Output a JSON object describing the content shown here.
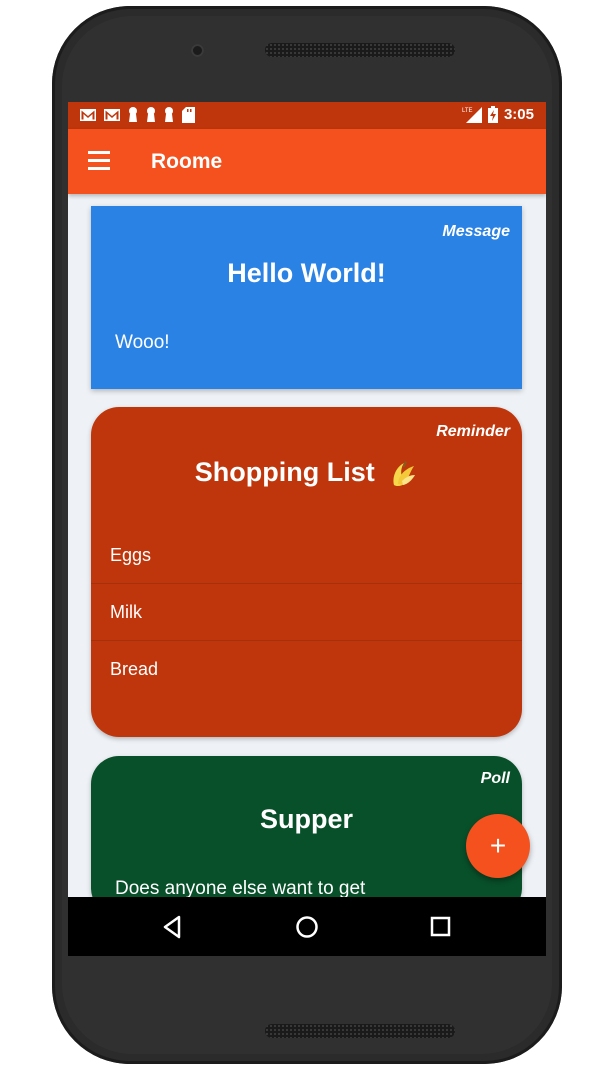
{
  "app": {
    "title": "Roome"
  },
  "status_bar": {
    "time": "3:05",
    "network": "LTE"
  },
  "cards": {
    "message": {
      "type": "Message",
      "title": "Hello World!",
      "body": "Wooo!"
    },
    "reminder": {
      "type": "Reminder",
      "title": "Shopping List",
      "items": [
        "Eggs",
        "Milk",
        "Bread"
      ]
    },
    "poll": {
      "type": "Poll",
      "title": "Supper",
      "body": "Does anyone else want to get"
    }
  },
  "fab": {
    "label": "+"
  },
  "colors": {
    "status_bar": "#bf360c",
    "app_bar": "#f4511e",
    "message_card": "#2a82e4",
    "reminder_card": "#bf360c",
    "poll_card": "#08502a",
    "background": "#eef2f6"
  },
  "icons": {
    "status_left": [
      "gmail-icon",
      "gmail-icon",
      "keyhole-icon",
      "keyhole-icon",
      "keyhole-icon",
      "sd-card-icon"
    ],
    "status_right": [
      "lte-signal-icon",
      "battery-charging-icon"
    ],
    "nav": [
      "back-icon",
      "home-icon",
      "recents-icon"
    ],
    "menu": "hamburger-menu-icon",
    "fab": "plus-icon",
    "title_emoji": "banana-icon"
  }
}
